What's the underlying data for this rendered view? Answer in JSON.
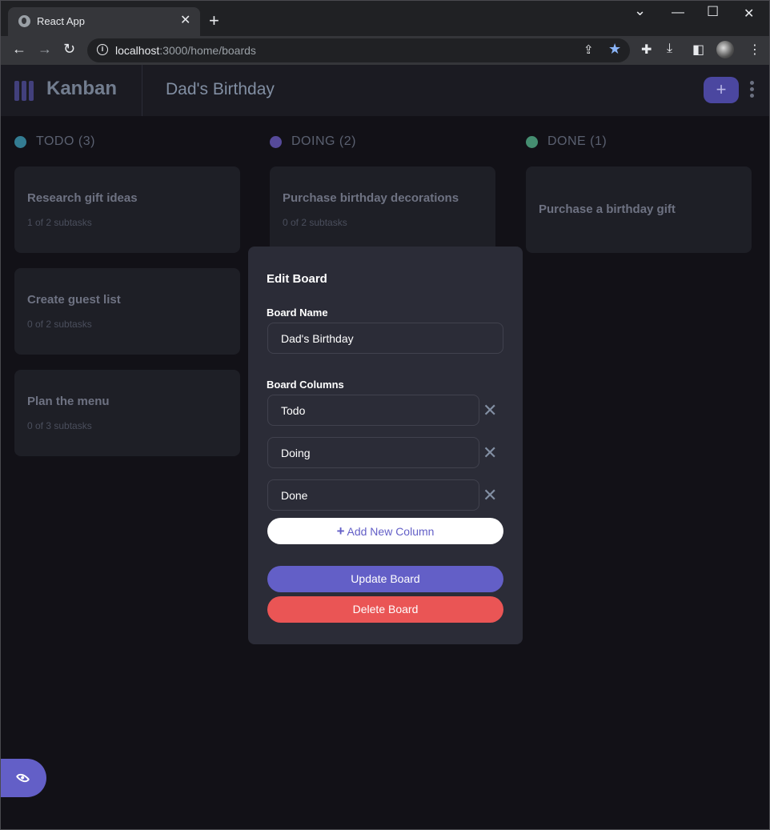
{
  "browser": {
    "tab_title": "React App",
    "tab_close": "✕",
    "new_tab": "+",
    "url_host": "localhost",
    "url_rest": ":3000/home/boards",
    "window_controls": {
      "minimize": "—",
      "maximize": "☐",
      "close": "✕",
      "tabsearch": "⌄"
    }
  },
  "header": {
    "logo": "Kanban",
    "board_name": "Dad's Birthday",
    "add_task_label": "+"
  },
  "columns": [
    {
      "label": "TODO (3)",
      "color": "#49c4e5",
      "cards": [
        {
          "title": "Research gift ideas",
          "subtasks": "1 of 2 subtasks"
        },
        {
          "title": "Create guest list",
          "subtasks": "0 of 2 subtasks"
        },
        {
          "title": "Plan the menu",
          "subtasks": "0 of 3 subtasks"
        }
      ]
    },
    {
      "label": "DOING (2)",
      "color": "#8471f2",
      "cards": [
        {
          "title": "Purchase birthday decorations",
          "subtasks": "0 of 2 subtasks"
        }
      ]
    },
    {
      "label": "DONE (1)",
      "color": "#67e2ae",
      "cards": [
        {
          "title": "Purchase a birthday gift"
        }
      ]
    }
  ],
  "modal": {
    "title": "Edit Board",
    "board_name_label": "Board Name",
    "board_name_value": "Dad's Birthday",
    "columns_label": "Board Columns",
    "column_values": [
      "Todo",
      "Doing",
      "Done"
    ],
    "remove_icon": "✕",
    "add_column_label": "Add New Column",
    "add_column_plus": "+",
    "update_label": "Update Board",
    "delete_label": "Delete Board"
  },
  "colors": {
    "accent": "#635fc7",
    "danger": "#ea5555",
    "modal_bg": "#2b2c37",
    "page_bg": "#121117"
  }
}
